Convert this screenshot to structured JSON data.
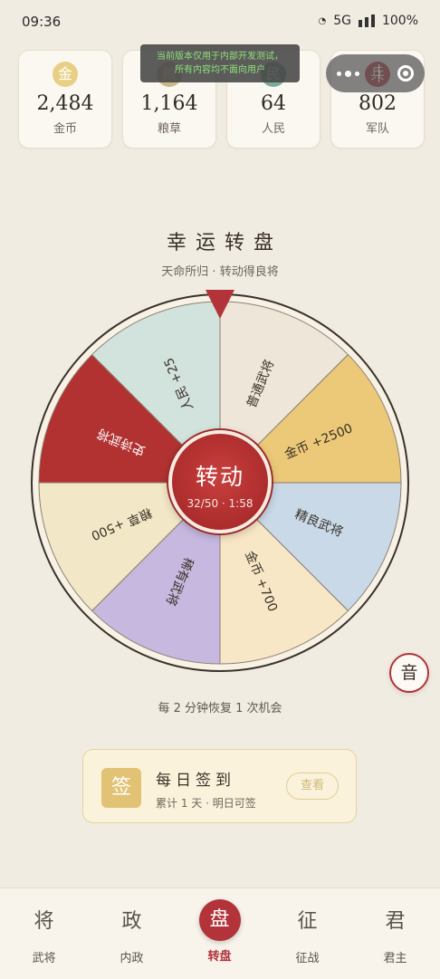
{
  "status_bar": {
    "time": "09:36",
    "network": "5G",
    "battery": "100%"
  },
  "dev_notice": {
    "line1": "当前版本仅用于内部开发测试，",
    "line2": "所有内容均不面向用户"
  },
  "resources": [
    {
      "icon": "金",
      "value": "2,484",
      "label": "金币",
      "icon_bg": "#e8cf86",
      "icon_color": "#ffffff"
    },
    {
      "icon": "粮",
      "value": "1,164",
      "label": "粮草",
      "icon_bg": "#c9b98a",
      "icon_color": "#ffffff"
    },
    {
      "icon": "民",
      "value": "64",
      "label": "人民",
      "icon_bg": "#7fa99b",
      "icon_color": "#ffffff"
    },
    {
      "icon": "兵",
      "value": "802",
      "label": "军队",
      "icon_bg": "#b2333a",
      "icon_color": "#ffffff"
    }
  ],
  "wheel": {
    "title": "幸运转盘",
    "subtitle": "天命所归 · 转动得良将",
    "segments": [
      {
        "label": "普通武将",
        "color": "#efe6da"
      },
      {
        "label": "金币 +2500",
        "color": "#ecc978"
      },
      {
        "label": "精良武将",
        "color": "#c9d9e8"
      },
      {
        "label": "金币 +700",
        "color": "#f8e7c6"
      },
      {
        "label": "稀有武将",
        "color": "#c7b8df"
      },
      {
        "label": "粮草 +500",
        "color": "#f2e8c8"
      },
      {
        "label": "史诗武将",
        "color": "#b23232"
      },
      {
        "label": "人民 +25",
        "color": "#d2e2dc"
      }
    ],
    "spin_label": "转动",
    "spin_counter": "32/50 · 1:58",
    "recover_text": "每 2 分钟恢复 1 次机会",
    "pointer_color": "#b2333a"
  },
  "sound_button": {
    "label": "音"
  },
  "daily_checkin": {
    "icon": "签",
    "title": "每日签到",
    "subtitle": "累计 1 天 · 明日可签",
    "button": "查看"
  },
  "tabs": [
    {
      "glyph": "将",
      "label": "武将",
      "active": false
    },
    {
      "glyph": "政",
      "label": "内政",
      "active": false
    },
    {
      "glyph": "盘",
      "label": "转盘",
      "active": true
    },
    {
      "glyph": "征",
      "label": "征战",
      "active": false
    },
    {
      "glyph": "君",
      "label": "君主",
      "active": false
    }
  ]
}
